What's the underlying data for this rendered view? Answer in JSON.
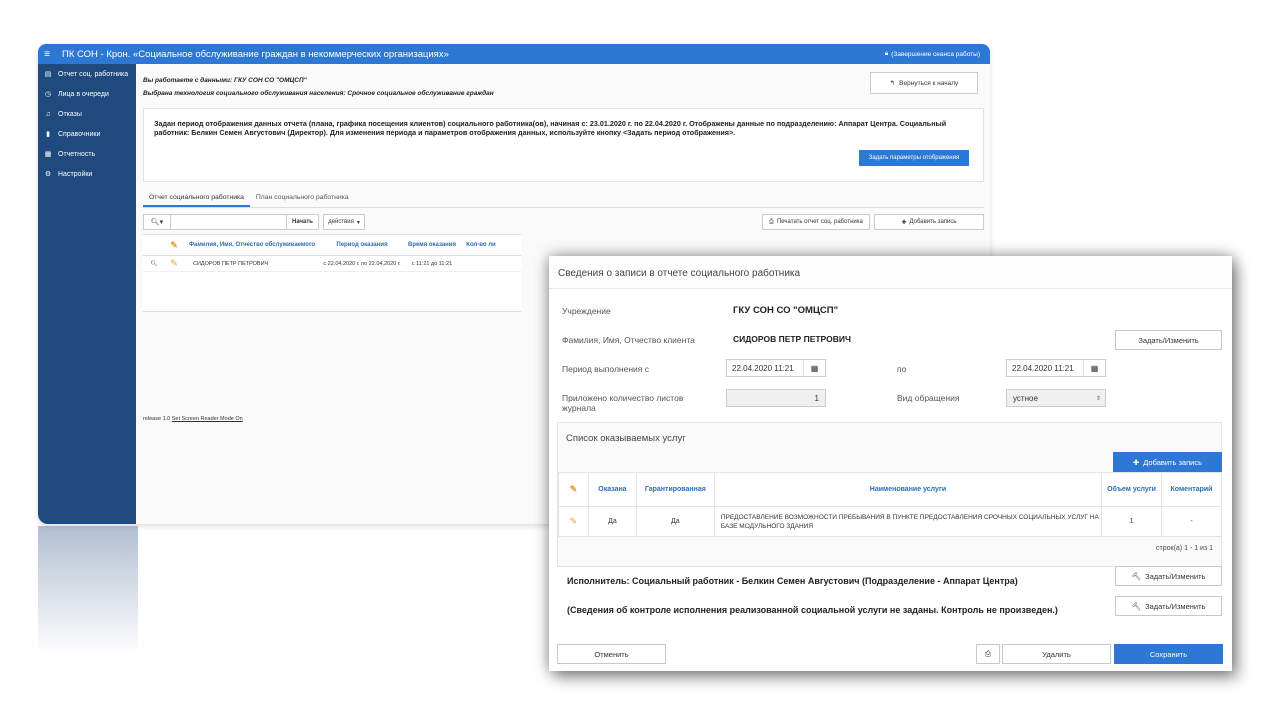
{
  "app": {
    "title": "ПК СОН - Крон. «Социальное обслуживание граждан в некоммерческих организациях»",
    "session_label": "(Завершение сеанса работы)",
    "sidebar": {
      "items": [
        {
          "label": "Отчет соц. работника",
          "icon": "list-icon"
        },
        {
          "label": "Лица в очереди",
          "icon": "clock-icon"
        },
        {
          "label": "Отказы",
          "icon": "bell-icon"
        },
        {
          "label": "Справочники",
          "icon": "book-icon"
        },
        {
          "label": "Отчетность",
          "icon": "table-icon"
        },
        {
          "label": "Настройки",
          "icon": "gears-icon"
        }
      ]
    },
    "info": {
      "working_with": "Вы работаете с данными: ГКУ СОН СО \"ОМЦСП\"",
      "technology": "Выбрана технология социального обслуживания населения: Срочное социальное обслуживание граждан"
    },
    "back_button": "Вернуться к началу",
    "period_text": "Задан период отображения данных отчета (плана, графика посещения клиентов) социального работника(ов), начиная с: 23.01.2020 г. по 22.04.2020 г. Отображены данные по подразделению: Аппарат Центра. Социальный работник: Белкин Семен Августович (Директор). Для изменения периода и параметров отображения данных, используйте кнопку <Задать период отображения>.",
    "period_button": "Задать параметры отображения",
    "tabs": [
      "Отчет социального работника",
      "План социального работника"
    ],
    "toolbar": {
      "search_button": "Начать",
      "actions_button": "действия",
      "print_button": "Печатать отчет соц. работника",
      "add_button": "Добавить запись"
    },
    "table": {
      "headers": [
        "Фамилия, Имя, Отчество обслуживаемого",
        "Период оказания",
        "Время оказания",
        "Кол-во ли"
      ],
      "rows": [
        {
          "name": "СИДОРОВ ПЕТР ПЕТРОВИЧ",
          "period": "с 22.04.2020 г. по 22.04.2020 г.",
          "time": "с 11:21 до 11:21"
        }
      ]
    },
    "release": "release 1.0",
    "screen_reader": "Set Screen Reader Mode On",
    "colors": {
      "topbar": "#2d78d4",
      "sidebar": "#1e4a7e",
      "accent": "#2d78d4"
    }
  },
  "dialog": {
    "title": "Сведения о записи в отчете социального работника",
    "institution_label": "Учреждение",
    "institution_value": "ГКУ СОН СО \"ОМЦСП\"",
    "client_label": "Фамилия, Имя, Отчество клиента",
    "client_value": "СИДОРОВ ПЕТР ПЕТРОВИЧ",
    "set_change_button": "Задать/Изменить",
    "period_from_label": "Период выполнения с",
    "period_from_value": "22.04.2020 11:21",
    "period_to_label": "по",
    "period_to_value": "22.04.2020 11:21",
    "sheets_label": "Приложено количество листов журнала",
    "sheets_value": "1",
    "request_type_label": "Вид обращения",
    "request_type_value": "устное",
    "services": {
      "title": "Список оказываемых услуг",
      "add_button": "Добавить запись",
      "headers": {
        "rendered": "Оказана",
        "guaranteed": "Гарантированная",
        "name": "Наименование услуги",
        "volume": "Объем услуги",
        "comment": "Коментарий"
      },
      "rows": [
        {
          "rendered": "Да",
          "guaranteed": "Да",
          "name": "ПРЕДОСТАВЛЕНИЕ ВОЗМОЖНОСТИ ПРЕБЫВАНИЯ В ПУНКТЕ ПРЕДОСТАВЛЕНИЯ СРОЧНЫХ СОЦИАЛЬНЫХ УСЛУГ НА БАЗЕ МОДУЛЬНОГО ЗДАНИЯ",
          "volume": "1",
          "comment": "-"
        }
      ],
      "pager": "строк(а) 1 - 1 из 1"
    },
    "executor_text": "Исполнитель: Социальный работник - Белкин Семен Августович (Подразделение - Аппарат Центра)",
    "control_text": "(Сведения об контроле исполнения реализованной социальной услуги не заданы. Контроль не произведен.)",
    "set_change_button2": "Задать/Изменить",
    "set_change_button3": "Задать/Изменить",
    "cancel_button": "Отменить",
    "delete_button": "Удалить",
    "save_button": "Сохранить"
  }
}
